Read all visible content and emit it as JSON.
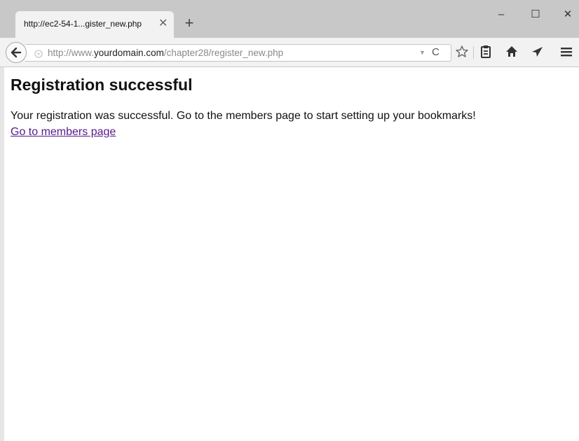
{
  "browser": {
    "tab": {
      "title": "http://ec2-54-1...gister_new.php",
      "close_glyph": "✕"
    },
    "new_tab_glyph": "+",
    "window_controls": {
      "minimize": "–",
      "maximize": "☐",
      "close": "✕"
    },
    "address": {
      "prefix": "http://www.",
      "host": "yourdomain.com",
      "path": "/chapter28/register_new.php",
      "dropdown_glyph": "▼",
      "reload_glyph": "C"
    },
    "toolbar_icons": [
      "back-arrow-icon",
      "star-icon",
      "clipboard-icon",
      "home-icon",
      "send-icon",
      "menu-icon"
    ]
  },
  "page": {
    "heading": "Registration successful",
    "message": "Your registration was successful. Go to the members page to start setting up your bookmarks!",
    "link_text": "Go to members page"
  },
  "colors": {
    "titlebar": "#c8c8c8",
    "toolbar": "#f2f2f2",
    "link_visited": "#551a8b"
  }
}
